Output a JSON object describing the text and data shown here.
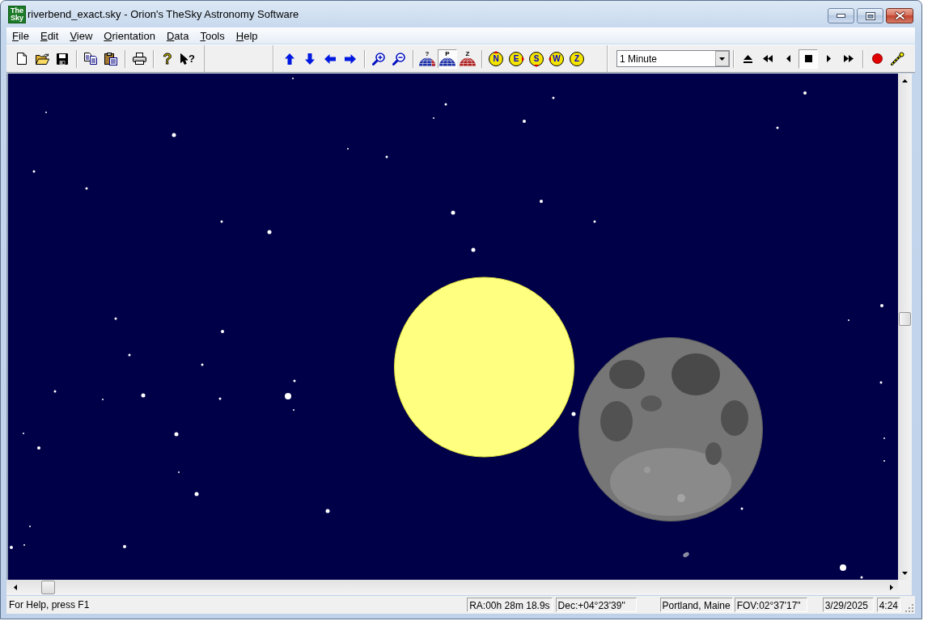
{
  "window": {
    "title": "riverbend_exact.sky - Orion's TheSky Astronomy Software",
    "logo_lines": [
      "The",
      "Sky"
    ]
  },
  "menu": [
    {
      "label": "File"
    },
    {
      "label": "Edit"
    },
    {
      "label": "View"
    },
    {
      "label": "Orientation"
    },
    {
      "label": "Data"
    },
    {
      "label": "Tools"
    },
    {
      "label": "Help"
    }
  ],
  "toolbar": [
    {
      "groups": [
        [
          {
            "kind": "new",
            "pressed": false
          },
          {
            "kind": "open",
            "pressed": false
          },
          {
            "kind": "save",
            "pressed": false
          }
        ],
        [
          {
            "kind": "copy",
            "pressed": false
          },
          {
            "kind": "paste",
            "pressed": false
          }
        ],
        [
          {
            "kind": "print",
            "pressed": false
          }
        ],
        [
          {
            "kind": "help",
            "glyph": "?",
            "pressed": false
          },
          {
            "kind": "context-help",
            "glyph": "?",
            "pressed": false
          }
        ]
      ]
    },
    {
      "groups": [
        [
          {
            "kind": "up",
            "pressed": false
          },
          {
            "kind": "down",
            "pressed": false
          },
          {
            "kind": "left",
            "pressed": false
          },
          {
            "kind": "right",
            "pressed": false
          }
        ],
        [
          {
            "kind": "zoom-in",
            "pressed": false
          },
          {
            "kind": "zoom-out",
            "pressed": false
          }
        ],
        [
          {
            "kind": "dual-dome",
            "glyph": "?",
            "color": "#1c2fa8",
            "pressed": false
          },
          {
            "kind": "dome",
            "glyph": "P",
            "color": "#1c2fa8",
            "pressed": true
          },
          {
            "kind": "dome",
            "glyph": "Z",
            "color": "#b02020",
            "pressed": false
          }
        ],
        [
          {
            "kind": "north",
            "glyph": "N",
            "pressed": false
          },
          {
            "kind": "east",
            "glyph": "E",
            "pressed": false
          },
          {
            "kind": "south",
            "glyph": "S",
            "pressed": false
          },
          {
            "kind": "west",
            "glyph": "W",
            "pressed": false
          },
          {
            "kind": "zenith",
            "glyph": "Z",
            "pressed": false
          }
        ]
      ]
    },
    {
      "dropdown": {
        "value": "1 Minute"
      },
      "groups": [
        [
          {
            "kind": "eject",
            "pressed": false
          },
          {
            "kind": "rewind",
            "pressed": false
          },
          {
            "kind": "step-back",
            "pressed": false
          },
          {
            "kind": "stop",
            "pressed": true
          },
          {
            "kind": "play",
            "pressed": false
          },
          {
            "kind": "fast-forward",
            "pressed": false
          }
        ],
        [
          {
            "kind": "record",
            "pressed": false
          },
          {
            "kind": "wand",
            "pressed": false
          }
        ]
      ]
    }
  ],
  "status_bar": {
    "message": "For Help, press F1",
    "panels": [
      "RA:00h 28m 18.9s",
      "Dec:+04°23'39\"",
      "Portland, Maine",
      "FOV:02°37'17\"",
      "3/29/2025",
      "4:24"
    ]
  }
}
